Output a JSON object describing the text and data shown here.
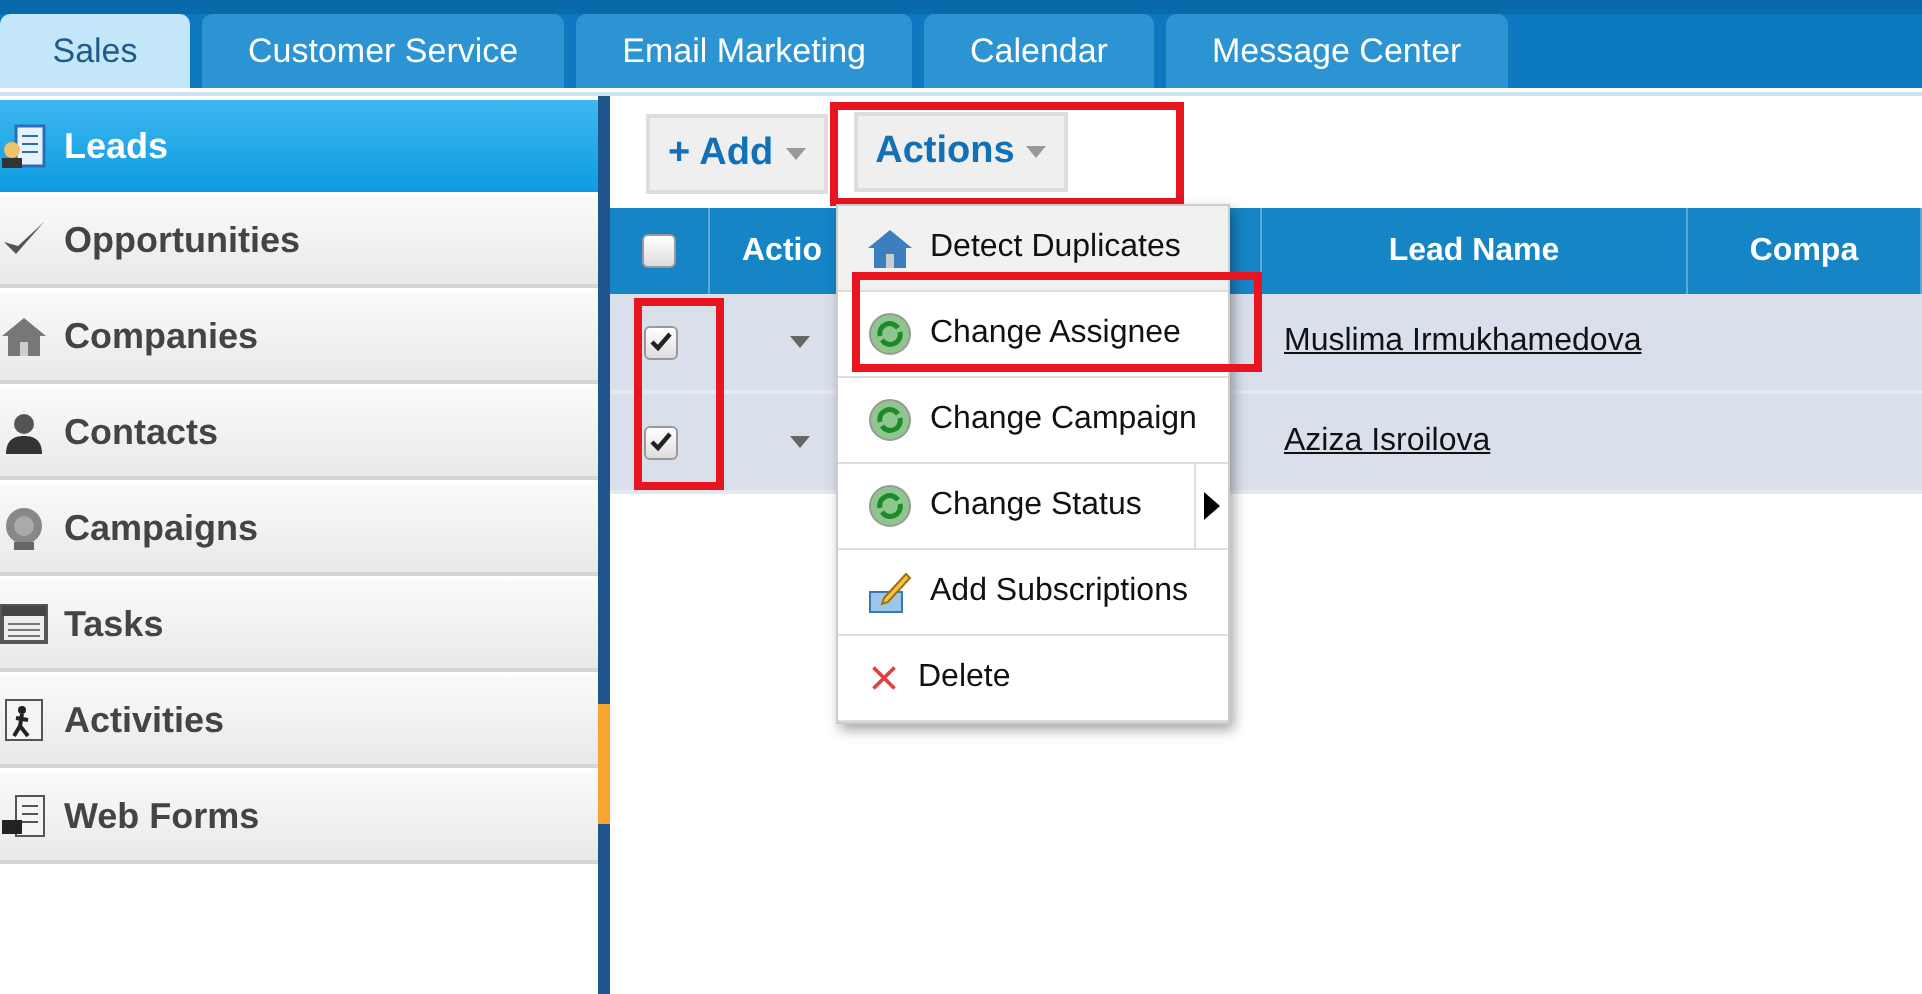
{
  "tabs": [
    {
      "label": "Sales",
      "selected": true
    },
    {
      "label": "Customer Service",
      "selected": false
    },
    {
      "label": "Email Marketing",
      "selected": false
    },
    {
      "label": "Calendar",
      "selected": false
    },
    {
      "label": "Message Center",
      "selected": false
    }
  ],
  "sidebar": {
    "items": [
      {
        "label": "Leads",
        "kind": "leads",
        "selected": true
      },
      {
        "label": "Opportunities",
        "kind": "check",
        "selected": false
      },
      {
        "label": "Companies",
        "kind": "house",
        "selected": false
      },
      {
        "label": "Contacts",
        "kind": "person",
        "selected": false
      },
      {
        "label": "Campaigns",
        "kind": "badge",
        "selected": false
      },
      {
        "label": "Tasks",
        "kind": "list",
        "selected": false
      },
      {
        "label": "Activities",
        "kind": "runner",
        "selected": false
      },
      {
        "label": "Web Forms",
        "kind": "forms",
        "selected": false
      }
    ]
  },
  "toolbar": {
    "buttons": [
      {
        "label": "+ Add",
        "highlighted": false
      },
      {
        "label": "Actions",
        "highlighted": true
      }
    ]
  },
  "table": {
    "columns": [
      {
        "kind": "select",
        "checked": false
      },
      {
        "label": "Actio",
        "kind": "action"
      },
      {
        "label": "Lead Name",
        "kind": "text"
      },
      {
        "label": "Compa",
        "kind": "text"
      }
    ],
    "selection_highlighted": true,
    "rows": [
      {
        "checked": true,
        "lead_name": "Muslima Irmukhamedova"
      },
      {
        "checked": true,
        "lead_name": "Aziza Isroilova"
      }
    ]
  },
  "actions_menu": {
    "items": [
      {
        "label": "Detect Duplicates",
        "kind": "house",
        "selected": true,
        "highlighted": false,
        "submenu": false
      },
      {
        "label": "Change Assignee",
        "kind": "refresh",
        "selected": false,
        "highlighted": true,
        "submenu": false
      },
      {
        "label": "Change Campaign",
        "kind": "refresh",
        "selected": false,
        "highlighted": false,
        "submenu": false
      },
      {
        "label": "Change Status",
        "kind": "refresh",
        "selected": false,
        "highlighted": false,
        "submenu": true
      },
      {
        "label": "Add Subscriptions",
        "kind": "pencil",
        "selected": false,
        "highlighted": false,
        "submenu": false
      },
      {
        "label": "Delete",
        "kind": "cross",
        "selected": false,
        "highlighted": false,
        "submenu": false
      }
    ]
  }
}
